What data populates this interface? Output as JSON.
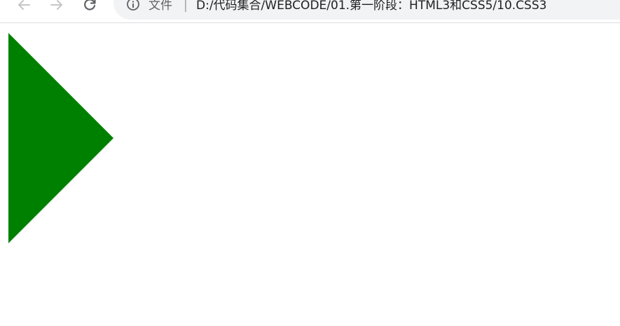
{
  "toolbar": {
    "back_icon": "arrow-left",
    "forward_icon": "arrow-right",
    "reload_icon": "reload",
    "info_icon": "info-circle",
    "file_label": "文件",
    "separator": "|",
    "url": "D:/代码集合/WEBCODE/01.第一阶段：HTML3和CSS5/10.CSS3"
  },
  "page": {
    "shape": "triangle-right",
    "shape_color": "#008000"
  }
}
